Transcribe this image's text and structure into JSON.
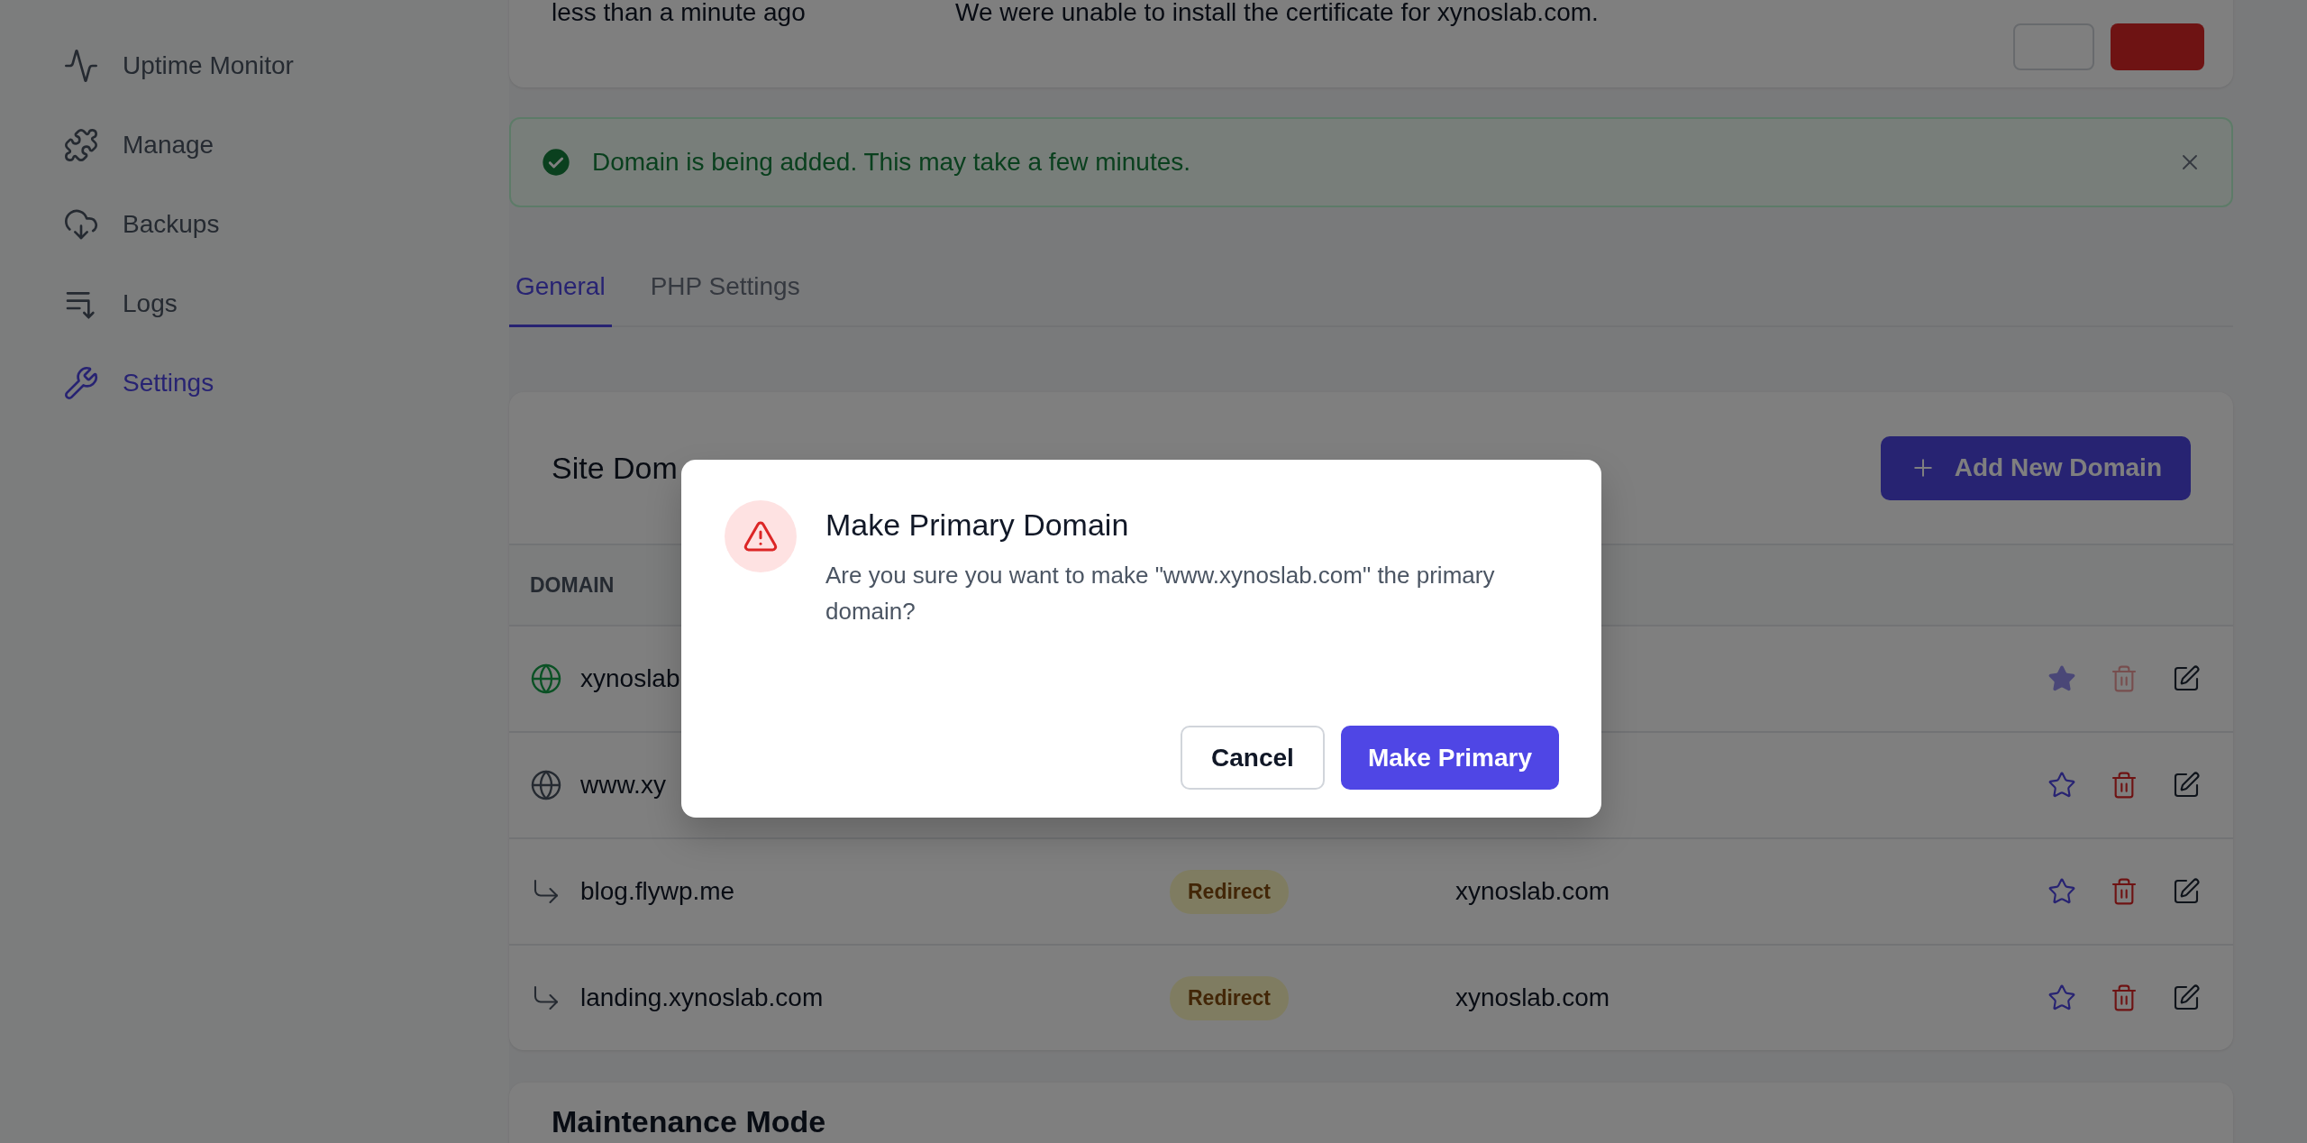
{
  "sidebar": {
    "items": [
      {
        "label": "Uptime Monitor",
        "kind": "activity",
        "selected": false
      },
      {
        "label": "Manage",
        "kind": "puzzle",
        "selected": false
      },
      {
        "label": "Backups",
        "kind": "cloud",
        "selected": false
      },
      {
        "label": "Logs",
        "kind": "logs",
        "selected": false
      },
      {
        "label": "Settings",
        "kind": "tools",
        "selected": true
      }
    ]
  },
  "notice": {
    "time": "less than a minute ago",
    "message": "We were unable to install the certificate for xynoslab.com."
  },
  "alert": {
    "message": "Domain is being added. This may take a few minutes."
  },
  "tabs": [
    {
      "label": "General",
      "selected": true
    },
    {
      "label": "PHP Settings",
      "selected": false
    }
  ],
  "domains_card": {
    "title": "Site Dom",
    "add_button": "Add New Domain",
    "columns": [
      "DOMAIN"
    ],
    "rows": [
      {
        "kind": "globe",
        "domain": "xynoslab",
        "primary": true
      },
      {
        "kind": "globe",
        "domain": "www.xy",
        "primary": false
      },
      {
        "kind": "redirect",
        "domain": "blog.flywp.me",
        "type": "Redirect",
        "target": "xynoslab.com",
        "primary": false
      },
      {
        "kind": "redirect",
        "domain": "landing.xynoslab.com",
        "type": "Redirect",
        "target": "xynoslab.com",
        "primary": false
      }
    ]
  },
  "maintenance": {
    "title": "Maintenance Mode"
  },
  "dialog": {
    "title": "Make Primary Domain",
    "message": "Are you sure you want to make \"www.xynoslab.com\" the primary domain?",
    "cancel": "Cancel",
    "confirm": "Make Primary"
  }
}
